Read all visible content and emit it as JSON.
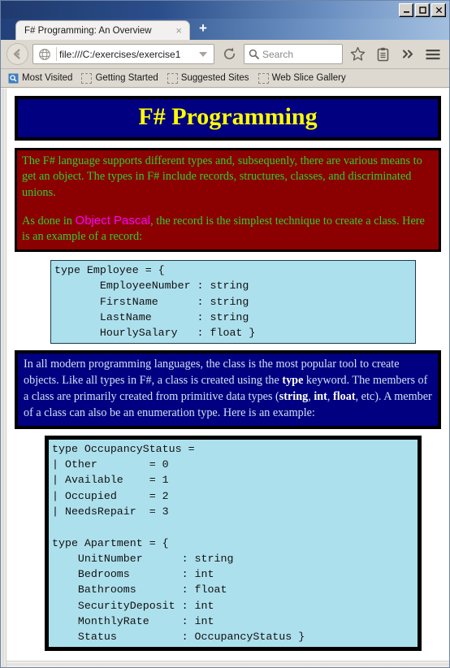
{
  "window": {
    "controls": [
      {
        "name": "minimize",
        "glyph": "_"
      },
      {
        "name": "maximize",
        "glyph": "□"
      },
      {
        "name": "close",
        "glyph": "✕"
      }
    ]
  },
  "tabbar": {
    "tab_title": "F# Programming: An Overview",
    "close_glyph": "×",
    "new_tab_glyph": "+"
  },
  "toolbar": {
    "back_label": "Back",
    "url_value": "file:///C:/exercises/exercise1",
    "reload_label": "Reload",
    "search_placeholder": "Search",
    "bookmark_icon": "star-icon",
    "library_icon": "clipboard-icon",
    "overflow_glyph": "»",
    "menu_icon": "hamburger-icon"
  },
  "bookmarks": [
    {
      "label": "Most Visited",
      "icon": "most-visited-icon"
    },
    {
      "label": "Getting Started",
      "icon": "placeholder-icon"
    },
    {
      "label": "Suggested Sites",
      "icon": "placeholder-icon"
    },
    {
      "label": "Web Slice Gallery",
      "icon": "placeholder-icon"
    }
  ],
  "page": {
    "banner_title": "F# Programming",
    "intro": {
      "paragraph1": "The F# language supports different types and, subsequenly, there are various means to get an object. The types in F# include records, structures, classes, and discriminated unions.",
      "paragraph2_pre": "As done in ",
      "paragraph2_highlight": "Object Pascal",
      "paragraph2_post": ", the record is the simplest technique to create a class. Here is an example of a record:"
    },
    "code_block_1": "type Employee = {\n       EmployeeNumber : string\n       FirstName      : string\n       LastName       : string\n       HourlySalary   : float }",
    "class_note": {
      "s1": "In all modern programming languages, the class is the most popular tool to create objects. Like all types in F#, a class is created using the ",
      "kw1": "type",
      "s2": " keyword. The members of a class are primarily created from primitive data types (",
      "kw2": "string",
      "s3": ", ",
      "kw3": "int",
      "s4": ", ",
      "kw4": "float",
      "s5": ", etc). A member of a class can also be an enumeration type. Here is an example:"
    },
    "code_block_2": "type OccupancyStatus =\n| Other        = 0\n| Available    = 1\n| Occupied     = 2\n| NeedsRepair  = 3\n\ntype Apartment = {\n    UnitNumber      : string\n    Bedrooms        : int\n    Bathrooms       : float\n    SecurityDeposit : int\n    MonthlyRate     : int\n    Status          : OccupancyStatus }"
  },
  "colors": {
    "banner_bg": "#000080",
    "banner_text": "#ffff00",
    "redbox_bg": "#8b0000",
    "redbox_text": "#33cc33",
    "highlight": "#ff00ff",
    "bluebox_bg": "#000080",
    "bluebox_text": "#cfe0f5",
    "code_bg": "#ade0ed"
  }
}
